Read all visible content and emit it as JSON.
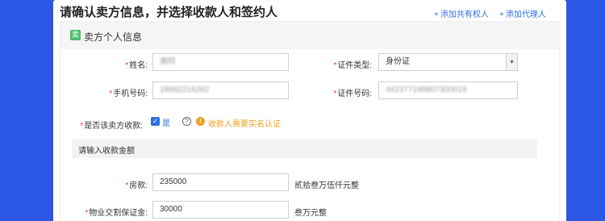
{
  "header": {
    "title": "请确认卖方信息，并选择收款人和签约人",
    "add_co_owner": "添加共有权人",
    "add_agent": "添加代理人",
    "plus": "+"
  },
  "section": {
    "icon_char": "卖",
    "title": "卖方个人信息"
  },
  "form": {
    "required_mark": "*",
    "name_label": "姓名:",
    "name_value": "谢欣",
    "id_type_label": "证件类型:",
    "id_type_value": "身份证",
    "phone_label": "手机号码:",
    "phone_value": "18682216282",
    "id_number_label": "证件号码:",
    "id_number_value": "442377198807300019",
    "is_seller_payee_label": "是否该卖方收款:",
    "is_seller_payee_checked": true,
    "is_seller_payee_option": "是",
    "help_icon_char": "?",
    "warn_icon_char": "!",
    "warning_text": "收款人需要实名认证",
    "amount_band_text": "请输入收款金额",
    "house_price_label": "房款:",
    "house_price_value": "235000",
    "house_price_cn": "贰拾叁万伍仟元整",
    "deposit_label": "物业交割保证金:",
    "deposit_value": "30000",
    "deposit_cn": "叁万元整"
  },
  "colors": {
    "background": "#2d58e6",
    "link": "#2d6fe0",
    "required": "#e23c3c",
    "warning": "#f0a020",
    "section_icon": "#4cbb6d"
  }
}
